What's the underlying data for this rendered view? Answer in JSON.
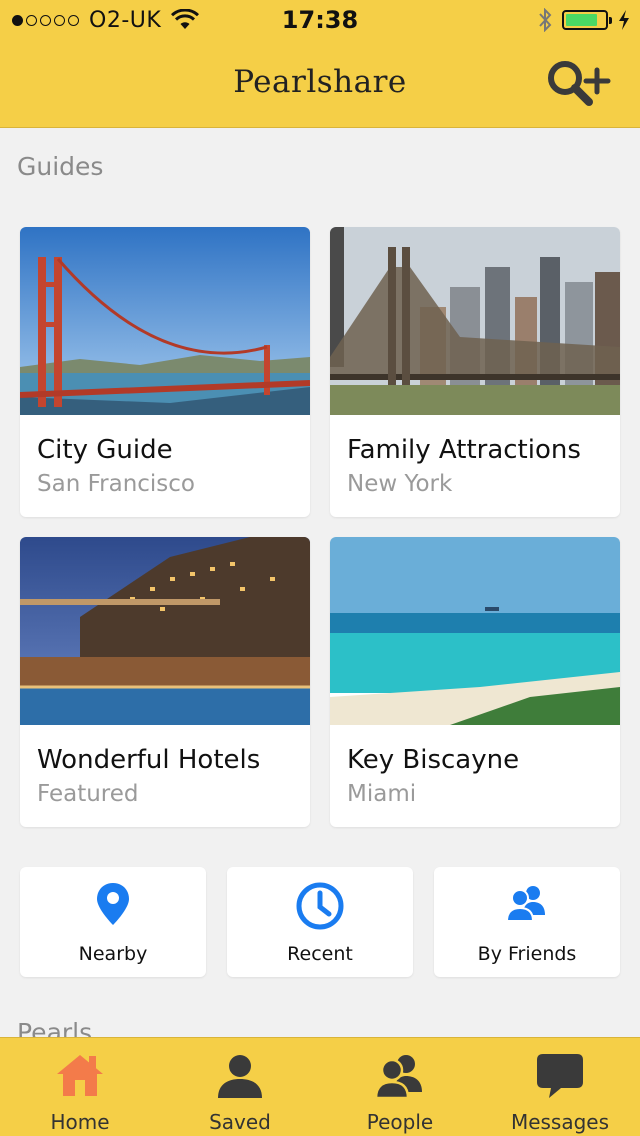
{
  "status_bar": {
    "carrier": "O2-UK",
    "time": "17:38",
    "signal_bars_filled": 1,
    "signal_bars_total": 5,
    "battery_level": 0.82,
    "icons": [
      "wifi-icon",
      "bluetooth-icon",
      "battery-icon",
      "charging-icon"
    ]
  },
  "header": {
    "title": "Pearlshare",
    "search_add_icon": "search-add-icon"
  },
  "guides": {
    "section_title": "Guides",
    "cards": [
      {
        "title": "City Guide",
        "subtitle": "San Francisco",
        "image": "golden-gate-bridge-photo"
      },
      {
        "title": "Family Attractions",
        "subtitle": "New York",
        "image": "queensboro-bridge-photo"
      },
      {
        "title": "Wonderful Hotels",
        "subtitle": "Featured",
        "image": "positano-hotel-photo"
      },
      {
        "title": "Key Biscayne",
        "subtitle": "Miami",
        "image": "miami-beach-photo"
      }
    ]
  },
  "quick_filters": [
    {
      "label": "Nearby",
      "icon": "location-pin-icon"
    },
    {
      "label": "Recent",
      "icon": "clock-icon"
    },
    {
      "label": "By Friends",
      "icon": "friends-icon"
    }
  ],
  "pearls": {
    "section_title": "Pearls"
  },
  "tabbar": {
    "tabs": [
      {
        "label": "Home",
        "icon": "home-icon",
        "active": true
      },
      {
        "label": "Saved",
        "icon": "person-icon",
        "active": false
      },
      {
        "label": "People",
        "icon": "people-icon",
        "active": false
      },
      {
        "label": "Messages",
        "icon": "chat-bubble-icon",
        "active": false
      }
    ]
  },
  "colors": {
    "brand_yellow": "#f5cf47",
    "accent_blue": "#1a7cf0",
    "active_orange": "#f37b4a",
    "icon_dark": "#3a3a3a",
    "background": "#f1f1f1"
  }
}
